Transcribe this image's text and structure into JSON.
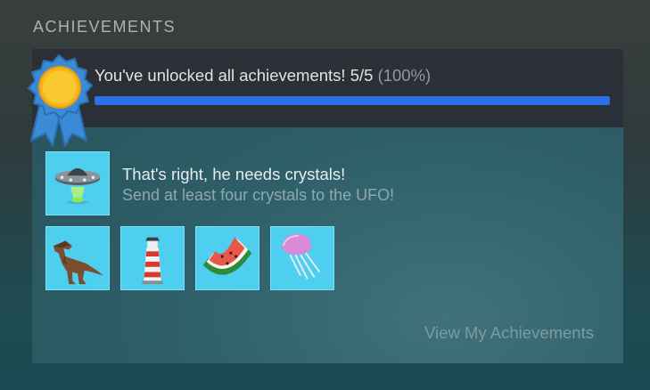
{
  "section": {
    "title": "ACHIEVEMENTS"
  },
  "summary": {
    "text": "You've unlocked all achievements! 5/5",
    "percent_text": "(100%)",
    "progress": 1.0
  },
  "featured": {
    "icon": "ufo-icon",
    "title": "That's right, he needs crystals!",
    "description": "Send at least four crystals to the UFO!"
  },
  "achievements": [
    {
      "icon": "dinosaur-icon"
    },
    {
      "icon": "lighthouse-icon"
    },
    {
      "icon": "watermelon-icon"
    },
    {
      "icon": "jellyfish-icon"
    }
  ],
  "links": {
    "view_achievements": "View My Achievements"
  },
  "colors": {
    "progress": "#2f6fe8",
    "tile": "#4fcfef",
    "badge": "#3a8ad6",
    "sun": "#f5b81c"
  }
}
